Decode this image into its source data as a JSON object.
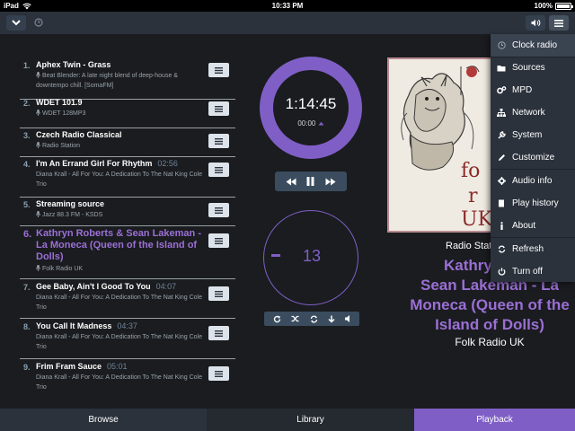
{
  "status_bar": {
    "device": "iPad",
    "time": "10:33 PM",
    "battery": "100%"
  },
  "queue": [
    {
      "num": "1.",
      "title": "Aphex Twin - Grass",
      "duration": "",
      "sub": "Beat Blender: A late night blend of deep-house & downtempo chill. [SomaFM]",
      "radio": true,
      "active": false
    },
    {
      "num": "2.",
      "title": "WDET 101.9",
      "duration": "",
      "sub": "WDET 128MP3",
      "radio": true,
      "active": false
    },
    {
      "num": "3.",
      "title": "Czech Radio Classical",
      "duration": "",
      "sub": "Radio Station",
      "radio": true,
      "active": false
    },
    {
      "num": "4.",
      "title": "I'm An Errand Girl For Rhythm",
      "duration": "02:56",
      "sub": "Diana Krall - All For You: A Dedication To The Nat King Cole Trio",
      "radio": false,
      "active": false
    },
    {
      "num": "5.",
      "title": "Streaming source",
      "duration": "",
      "sub": "Jazz 88.3 FM - KSDS",
      "radio": true,
      "active": false
    },
    {
      "num": "6.",
      "title": "Kathryn Roberts & Sean Lakeman - La Moneca (Queen of the Island of Dolls)",
      "duration": "",
      "sub": "Folk Radio UK",
      "radio": true,
      "active": true
    },
    {
      "num": "7.",
      "title": "Gee Baby, Ain't I Good To You",
      "duration": "04:07",
      "sub": "Diana Krall - All For You: A Dedication To The Nat King Cole Trio",
      "radio": false,
      "active": false
    },
    {
      "num": "8.",
      "title": "You Call It Madness",
      "duration": "04:37",
      "sub": "Diana Krall - All For You: A Dedication To The Nat King Cole Trio",
      "radio": false,
      "active": false
    },
    {
      "num": "9.",
      "title": "Frim Fram Sauce",
      "duration": "05:01",
      "sub": "Diana Krall - All For You: A Dedication To The Nat King Cole Trio",
      "radio": false,
      "active": false
    }
  ],
  "playback": {
    "elapsed": "1:14:45",
    "total": "00:00",
    "volume": "13",
    "progress": 1.0
  },
  "now_playing": {
    "label": "Radio Stat",
    "title": "Kathryn Roberts & Sean Lakeman - La Moneca (Queen of the Island of Dolls)",
    "title_visible": "Kathryn Rob\nSean Lakeman - La\nMoneca (Queen of the\nIsland of Dolls)",
    "artist": "Folk Radio UK"
  },
  "cover_text": [
    "fo",
    "r",
    "UK"
  ],
  "menu": [
    {
      "label": "Clock radio",
      "icon": "clock-icon"
    },
    {
      "label": "Sources",
      "icon": "folder-icon"
    },
    {
      "label": "MPD",
      "icon": "cogs-icon"
    },
    {
      "label": "Network",
      "icon": "network-icon"
    },
    {
      "label": "System",
      "icon": "wrench-icon"
    },
    {
      "label": "Customize",
      "icon": "pencil-icon"
    },
    {
      "label": "Audio info",
      "icon": "gear-icon"
    },
    {
      "label": "Play history",
      "icon": "book-icon"
    },
    {
      "label": "About",
      "icon": "info-icon"
    },
    {
      "label": "Refresh",
      "icon": "refresh-icon"
    },
    {
      "label": "Turn off",
      "icon": "power-icon"
    }
  ],
  "tabs": {
    "browse": "Browse",
    "library": "Library",
    "playback": "Playback"
  },
  "colors": {
    "accent": "#7f5fc6",
    "topbar": "#2b323c",
    "background": "#1a1c1f"
  }
}
